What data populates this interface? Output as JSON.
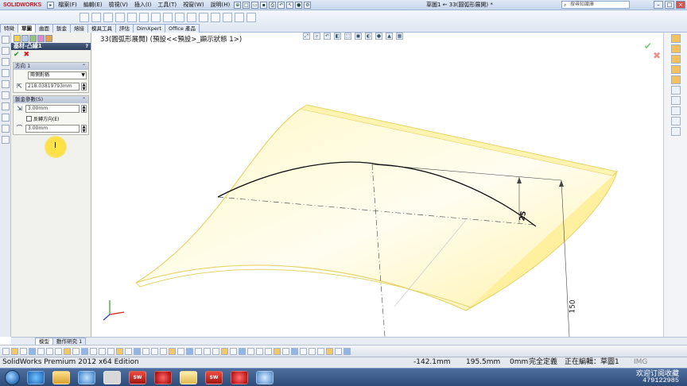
{
  "app": {
    "logo": "SOLIDWORKS",
    "document_title": "草圖1 ← 33(圓弧形展開) *",
    "search_placeholder": "搜尋知識庫"
  },
  "menu": [
    "檔案(F)",
    "編輯(E)",
    "檢視(V)",
    "插入(I)",
    "工具(T)",
    "視窗(W)",
    "說明(H)"
  ],
  "command_tabs": [
    "特徵",
    "草圖",
    "曲面",
    "鈑金",
    "熔接",
    "模具工具",
    "評估",
    "DimXpert",
    "Office 產品"
  ],
  "command_tab_active": "草圖",
  "property_manager": {
    "feature_name": "基材-凸緣1",
    "help_icon": "?",
    "direction_group": {
      "title": "方向 1",
      "end_condition": "兩側對稱",
      "depth_value": "218.03819793mm"
    },
    "sheet_metal_group": {
      "title": "鈑金參數(S)",
      "thickness_value": "3.00mm",
      "reverse_direction_label": "反轉方向(E)",
      "bend_radius_value": "3.00mm"
    }
  },
  "graphics": {
    "tree_label": "33(圓弧形展開) (預設<<預設>_顯示狀態 1>)",
    "dimension_small": "25",
    "dimension_large": "150",
    "body_fill": "#fff6b8",
    "body_stroke": "#e9d66a"
  },
  "model_tabs": [
    "模型",
    "動作研究 1"
  ],
  "status_bar": {
    "edition": "SolidWorks Premium 2012 x64 Edition",
    "x_coord": "-142.1mm",
    "y_coord": "195.5mm",
    "z_coord": "0mm",
    "definition_state": "完全定義",
    "editing": "正在編輯：草圖1",
    "units": "IMG"
  },
  "tray": {
    "message": "欢迎订阅收藏",
    "number": "479122985"
  }
}
